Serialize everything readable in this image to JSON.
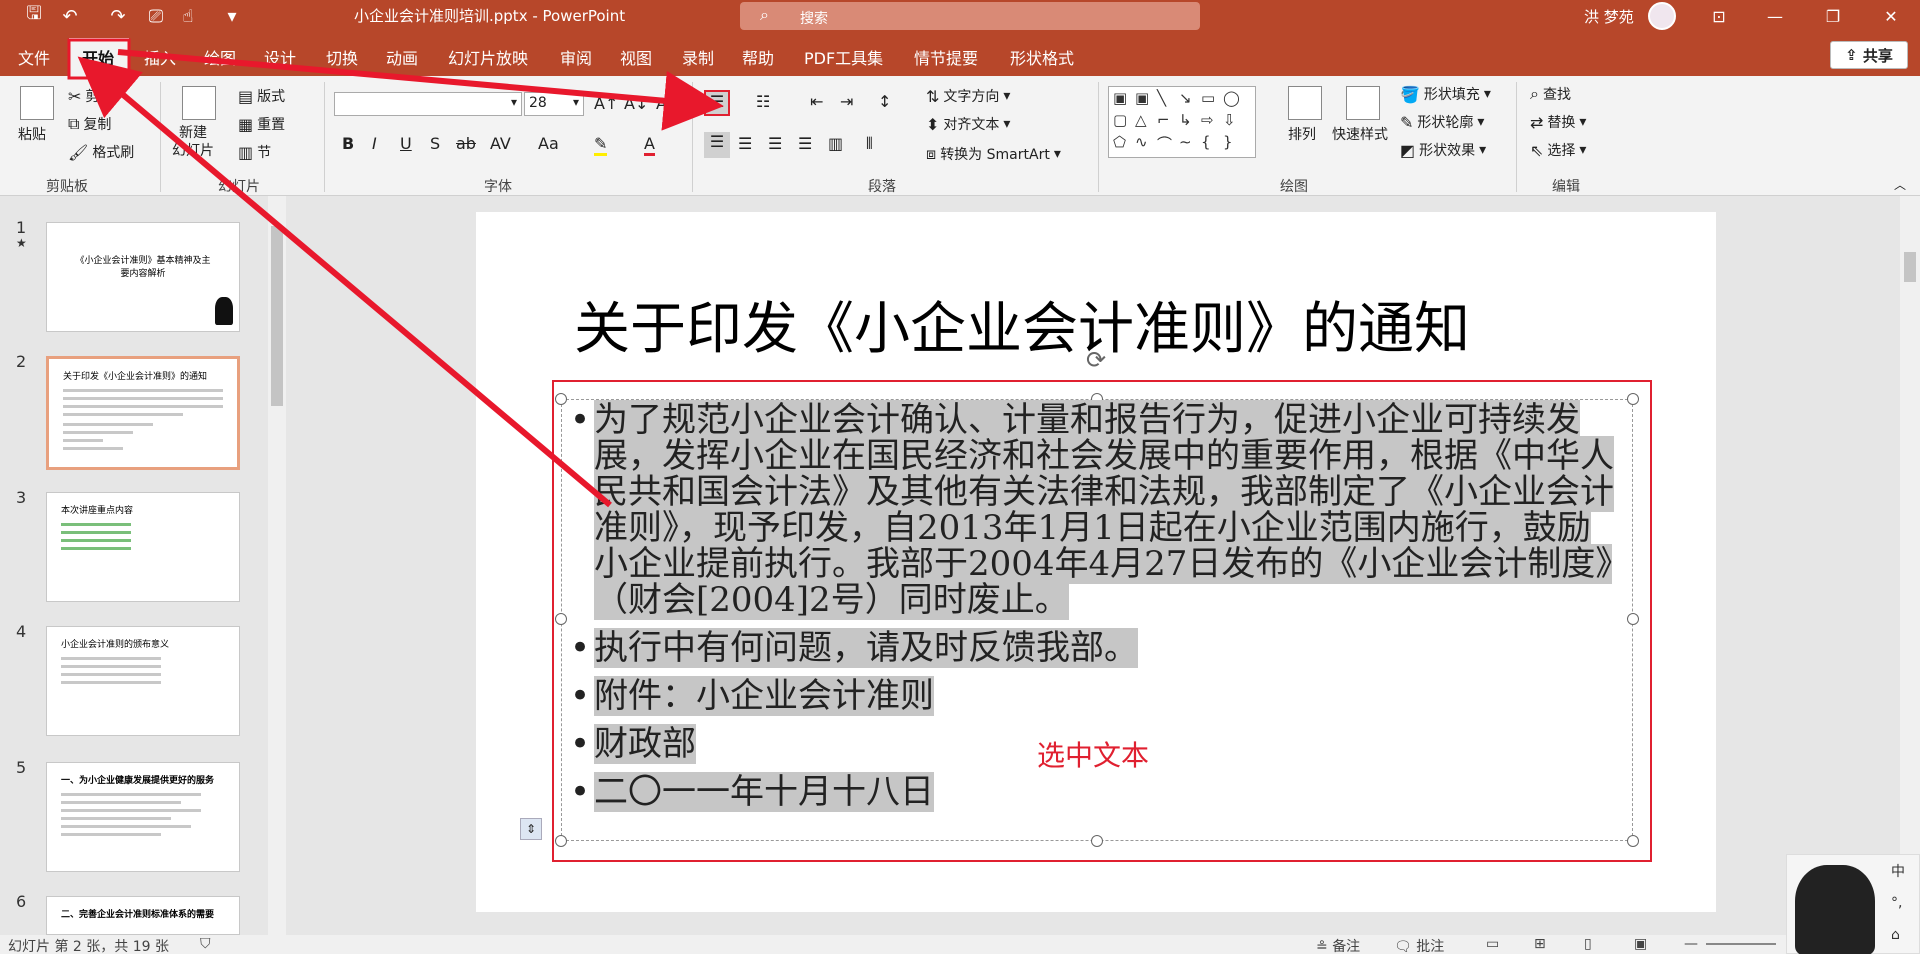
{
  "titlebar": {
    "document_title": "小企业会计准则培训.pptx  -  PowerPoint",
    "search_placeholder": "搜索",
    "user_name": "洪 梦苑"
  },
  "menu": {
    "tabs": [
      "文件",
      "开始",
      "插入",
      "绘图",
      "设计",
      "切换",
      "动画",
      "幻灯片放映",
      "审阅",
      "视图",
      "录制",
      "帮助",
      "PDF工具集",
      "情节提要",
      "形状格式"
    ],
    "active_tab": "开始",
    "share": "共享"
  },
  "ribbon": {
    "clipboard": {
      "paste": "粘贴",
      "cut": "剪切",
      "copy": "复制",
      "format_painter": "格式刷",
      "label": "剪贴板"
    },
    "slides": {
      "new_slide": "新建\n幻灯片",
      "layout": "版式",
      "reset": "重置",
      "section": "节",
      "label": "幻灯片"
    },
    "font": {
      "font_name": "",
      "font_size": "28",
      "label": "字体"
    },
    "paragraph": {
      "text_direction": "文字方向",
      "align_text": "对齐文本",
      "smartart": "转换为 SmartArt",
      "label": "段落"
    },
    "drawing": {
      "arrange": "排列",
      "quick_styles": "快速样式",
      "shape_fill": "形状填充",
      "shape_outline": "形状轮廓",
      "shape_effects": "形状效果",
      "label": "绘图"
    },
    "editing": {
      "find": "查找",
      "replace": "替换",
      "select": "选择",
      "label": "编辑"
    }
  },
  "thumbnails": [
    {
      "number": "1",
      "title": "《小企业会计准则》基本精神及主要内容解析"
    },
    {
      "number": "2",
      "title": "关于印发《小企业会计准则》的通知"
    },
    {
      "number": "3",
      "title": "本次讲座重点内容"
    },
    {
      "number": "4",
      "title": "小企业会计准则的颁布意义"
    },
    {
      "number": "5",
      "title": "一、为小企业健康发展提供更好的服务"
    },
    {
      "number": "6",
      "title": "二、完善企业会计准则标准体系的需要"
    }
  ],
  "slide": {
    "title": "关于印发《小企业会计准则》的通知",
    "bullets": [
      "为了规范小企业会计确认、计量和报告行为，促进小企业可持续发展，发挥小企业在国民经济和社会发展中的重要作用，根据《中华人民共和国会计法》及其他有关法律和法规，我部制定了《小企业会计准则》，现予印发，自2013年1月1日起在小企业范围内施行，鼓励小企业提前执行。我部于2004年4月27日发布的《小企业会计制度》（财会[2004]2号）同时废止。",
      "执行中有何问题，请及时反馈我部。",
      "附件：小企业会计准则",
      "财政部",
      "二〇一一年十月十八日"
    ],
    "annotation": "选中文本"
  },
  "statusbar": {
    "slide_info": "幻灯片 第 2 张，共 19 张",
    "notes": "备注",
    "comments": "批注"
  },
  "colors": {
    "accent": "#b7472a",
    "highlight": "#e02030",
    "selection": "#c6c6c6"
  }
}
